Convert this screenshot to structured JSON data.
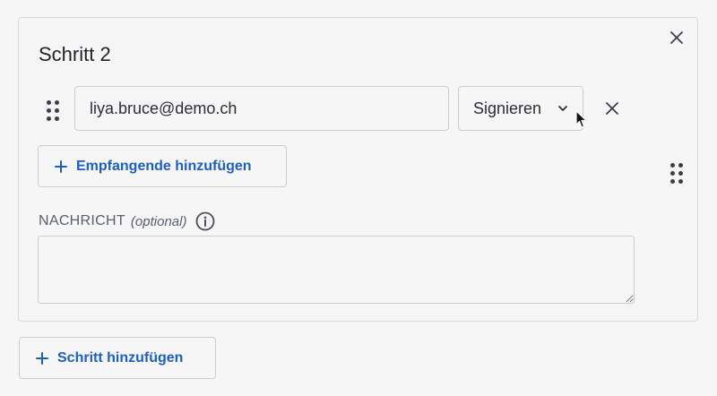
{
  "step": {
    "title": "Schritt 2"
  },
  "recipient": {
    "email": "liya.bruce@demo.ch",
    "role": "Signieren"
  },
  "buttons": {
    "add_recipient": "Empfangende hinzufügen",
    "add_step": "Schritt hinzufügen"
  },
  "message": {
    "label": "NACHRICHT",
    "optional": "(optional)",
    "value": ""
  },
  "icons": {
    "drag": "drag-handle-icon",
    "close": "close-icon",
    "chevron": "chevron-down-icon",
    "plus": "plus-icon",
    "info": "info-icon"
  },
  "colors": {
    "accent": "#1c5fc4",
    "text": "#1f2328",
    "muted": "#5a606a"
  }
}
